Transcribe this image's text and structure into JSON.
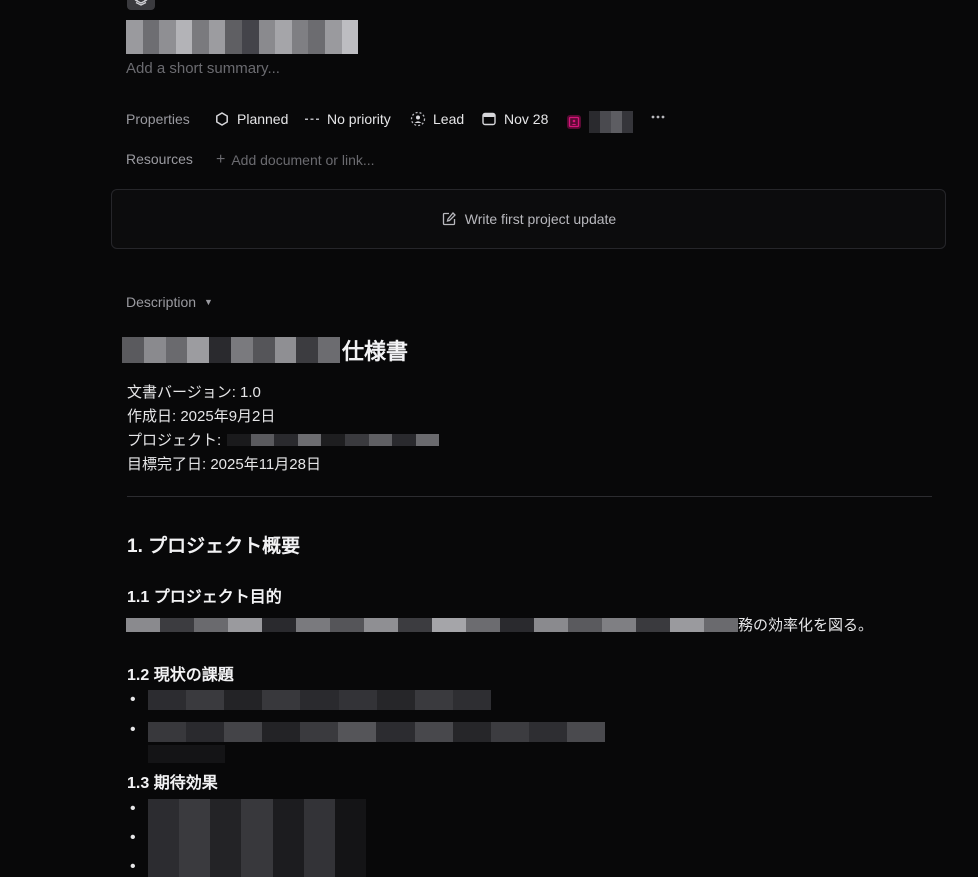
{
  "project": {
    "summary_placeholder": "Add a short summary..."
  },
  "properties": {
    "label": "Properties",
    "status": "Planned",
    "priority": "No priority",
    "lead": "Lead",
    "target_date": "Nov 28",
    "more_icon": "ellipsis-icon"
  },
  "resources": {
    "label": "Resources",
    "add_label": "Add document or link..."
  },
  "update": {
    "button_label": "Write first project update"
  },
  "description": {
    "label": "Description",
    "title_suffix": "仕様書",
    "meta": {
      "version": "文書バージョン: 1.0",
      "created": "作成日: 2025年9月2日",
      "project": "プロジェクト:",
      "target": "目標完了日: 2025年11月28日"
    },
    "sections": {
      "overview": "1. プロジェクト概要",
      "purpose_heading": "1.1 プロジェクト目的",
      "purpose_tail": "務の効率化を図る。",
      "issues_heading": "1.2 現状の課題",
      "effects_heading": "1.3 期待効果"
    }
  },
  "colors": {
    "background": "#080809",
    "text": "#e6e6e8",
    "muted": "#9a9aa0",
    "placeholder": "#6b6b70",
    "card_border": "#26262a",
    "team_accent": "#d6157a"
  }
}
